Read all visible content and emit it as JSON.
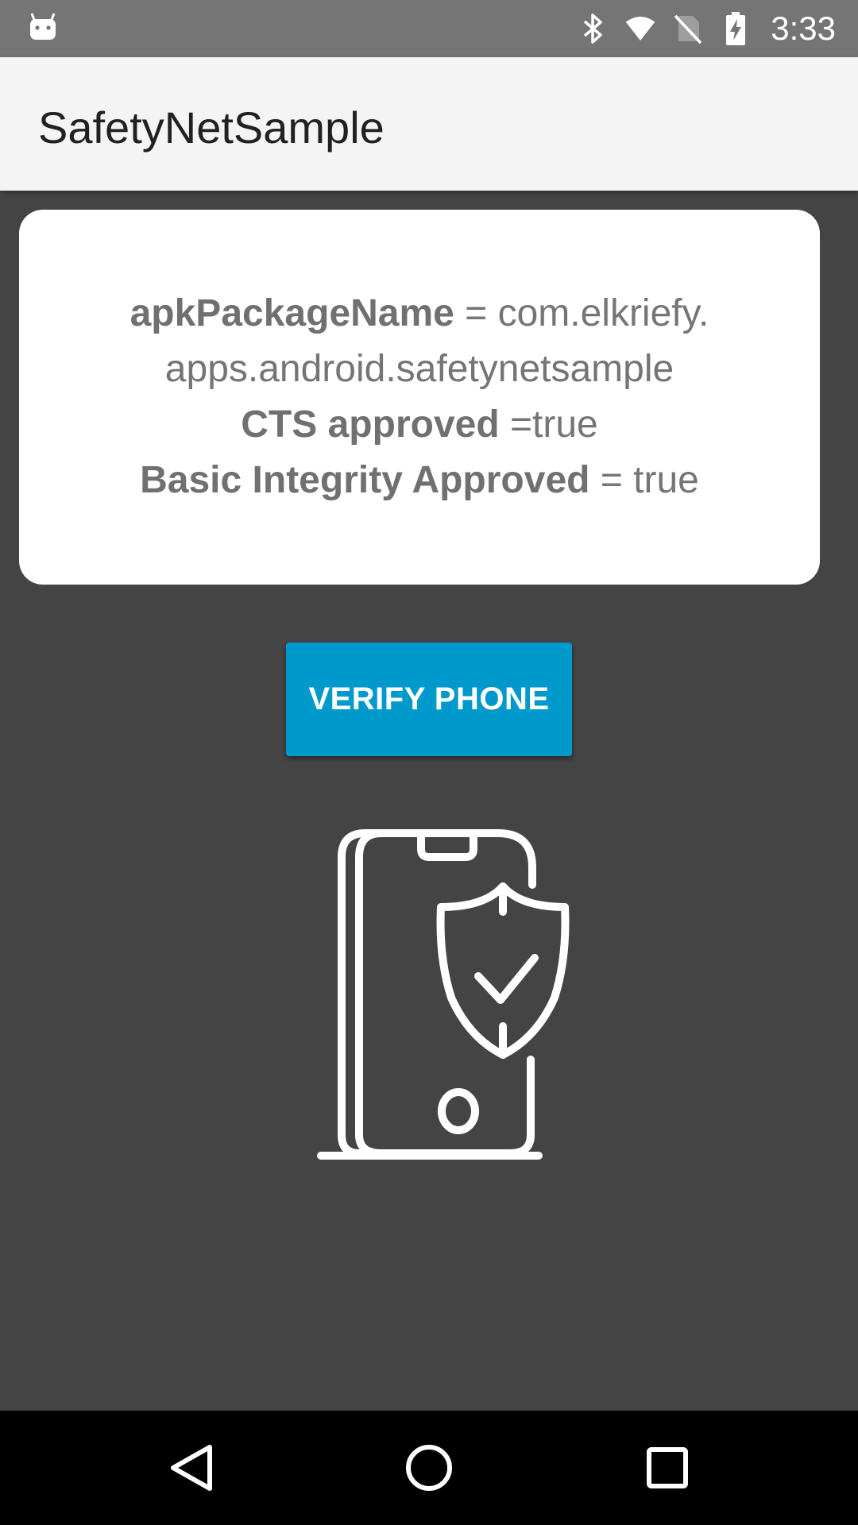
{
  "status_bar": {
    "time": "3:33",
    "icons": [
      "android-notification-icon",
      "bluetooth-icon",
      "wifi-icon",
      "no-sim-icon",
      "battery-charging-icon"
    ]
  },
  "app_bar": {
    "title": "SafetyNetSample"
  },
  "result_card": {
    "package_label": "apkPackageName",
    "package_value": " = com.elkriefy.",
    "package_value_cont": "apps.android.safetynetsample",
    "cts_label": "CTS approved",
    "cts_value": " =true",
    "basic_label": "Basic Integrity Approved",
    "basic_value": " = true"
  },
  "verify_button": {
    "label": "VERIFY PHONE"
  },
  "illustration": {
    "icon": "phone-shield-check-icon"
  },
  "nav_bar": {
    "buttons": [
      "back-icon",
      "home-icon",
      "recents-icon"
    ]
  },
  "colors": {
    "status_bar": "#757575",
    "app_bar": "#f4f4f4",
    "background": "#444444",
    "accent": "#0099cc",
    "nav_bar": "#000000"
  }
}
